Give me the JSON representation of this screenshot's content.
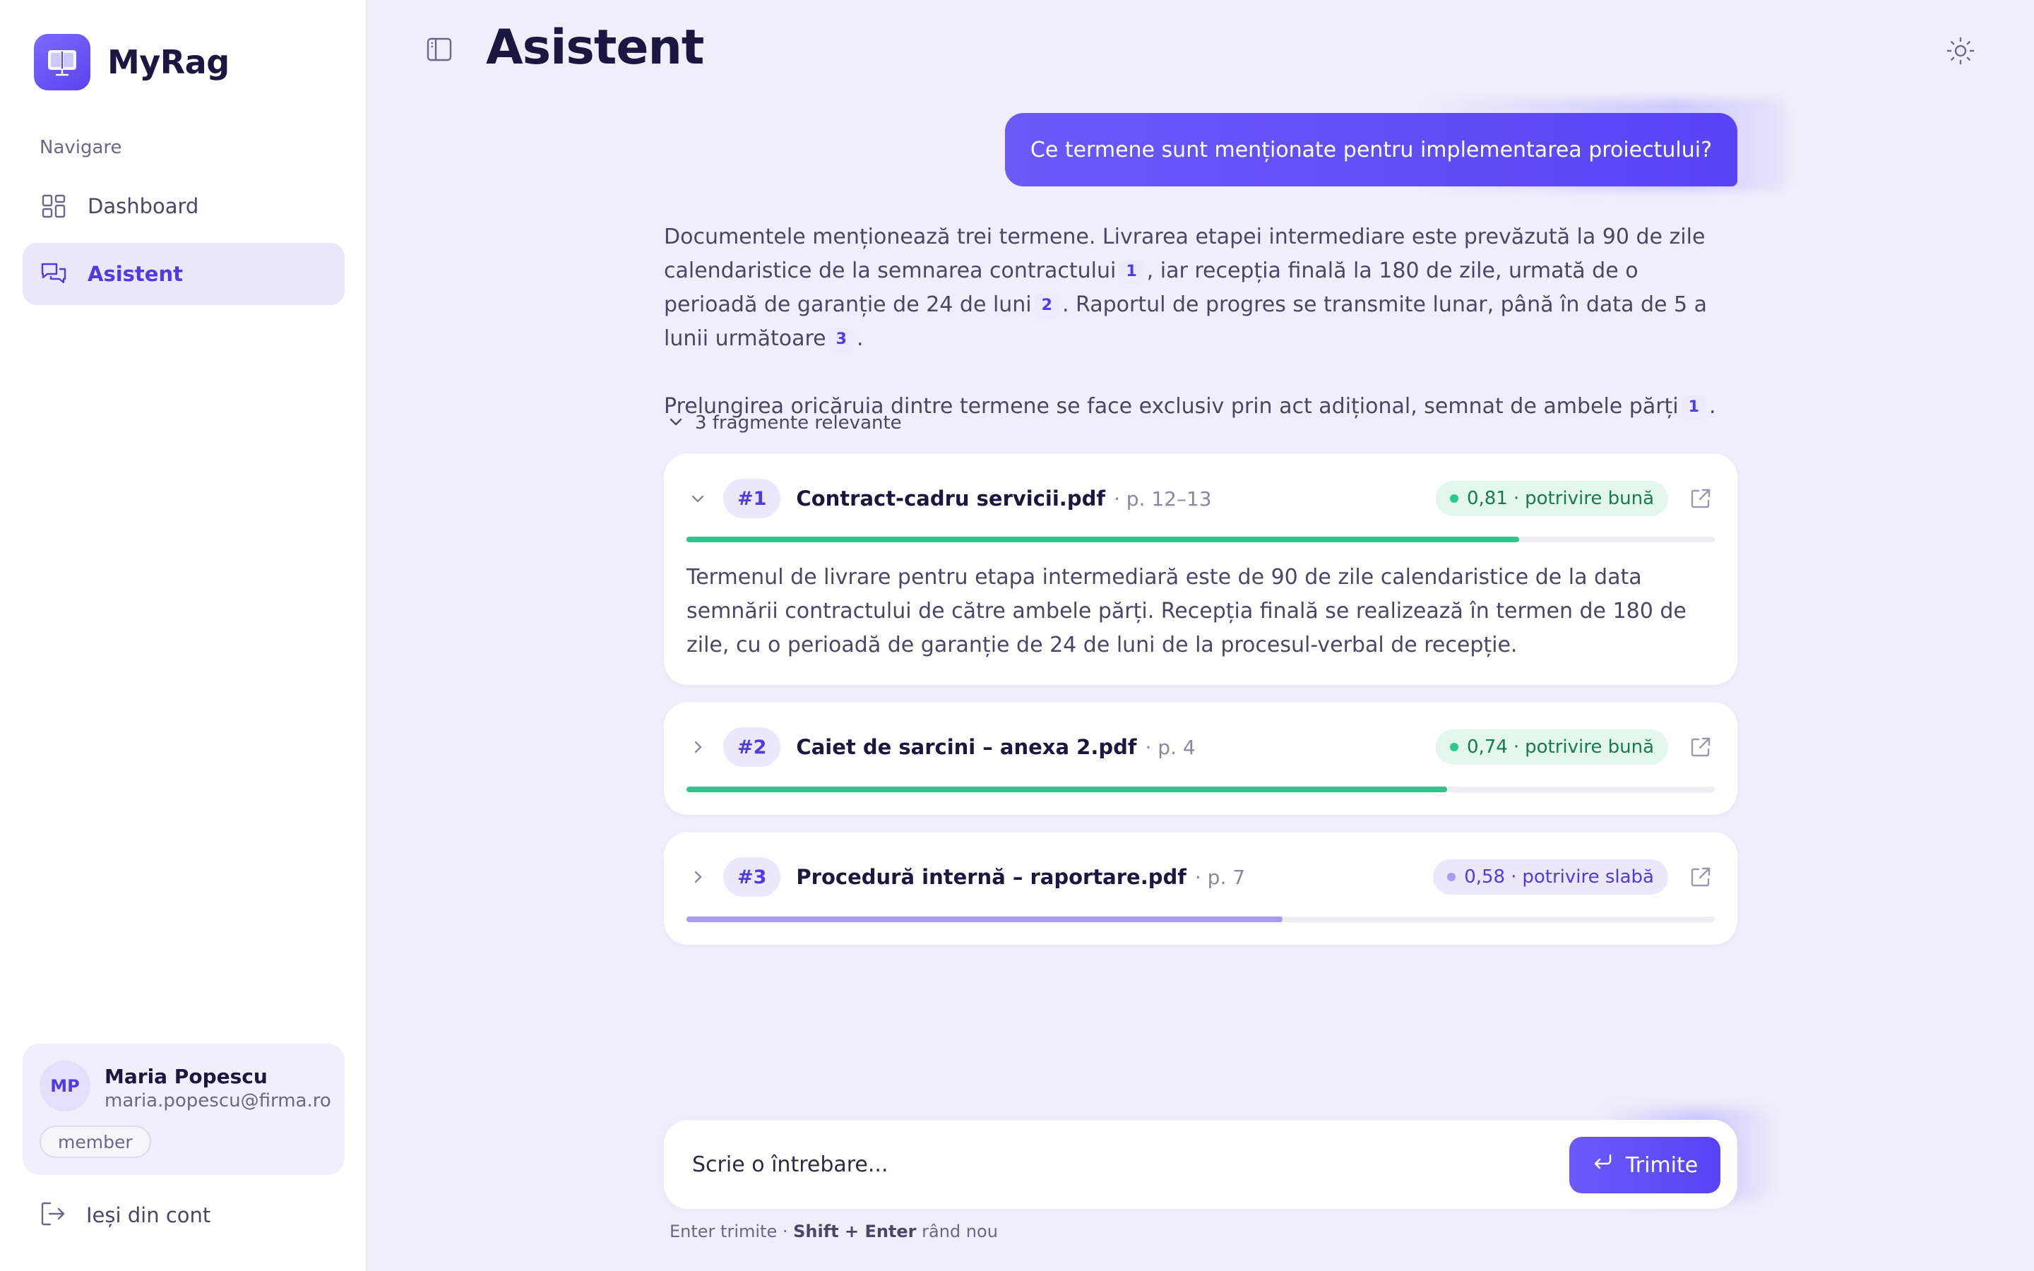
{
  "app": {
    "name": "MyRag"
  },
  "sidebar": {
    "nav_heading": "Navigare",
    "items": [
      {
        "label": "Dashboard",
        "icon": "grid-icon",
        "active": false
      },
      {
        "label": "Asistent",
        "icon": "chat-icon",
        "active": true
      }
    ],
    "user": {
      "initials": "MP",
      "name": "Maria Popescu",
      "email": "maria.popescu@firma.ro",
      "role": "member"
    },
    "logout_label": "Ieși din cont"
  },
  "header": {
    "title": "Asistent"
  },
  "chat": {
    "user_message": "Ce termene sunt menționate pentru implementarea proiectului?",
    "answer": {
      "p1_a": "Documentele menționează trei termene. Livrarea etapei intermediare este prevăzută la 90 de zile calendaristice de la semnarea contractului",
      "cite_1": "1",
      "p1_b": ", iar recepția finală la 180 de zile, urmată de o perioadă de garanție de 24 de luni",
      "cite_2": "2",
      "p1_c": ". Raportul de progres se transmite lunar, până în data de 5 a lunii următoare",
      "cite_3": "3",
      "p1_d": ".",
      "p2_a": "Prelungirea oricăruia dintre termene se face exclusiv prin act adițional, semnat de ambele părți",
      "cite_4": "1",
      "p2_b": "."
    },
    "fragments_toggle": "3 fragmente relevante",
    "fragments": [
      {
        "num": "#1",
        "file": "Contract-cadru servicii.pdf",
        "page": "· p. 12–13",
        "score": "0,81",
        "sep": "·",
        "match": "potrivire bună",
        "relevance": 0.81,
        "expanded": true,
        "text": "Termenul de livrare pentru etapa intermediară este de 90 de zile calendaristice de la data semnării contractului de către ambele părți. Recepția finală se realizează în termen de 180 de zile, cu o perioadă de garanție de 24 de luni de la procesul-verbal de recepție."
      },
      {
        "num": "#2",
        "file": "Caiet de sarcini – anexa 2.pdf",
        "page": "· p. 4",
        "score": "0,74",
        "sep": "·",
        "match": "potrivire bună",
        "relevance": 0.74,
        "expanded": false
      },
      {
        "num": "#3",
        "file": "Procedură internă – raportare.pdf",
        "page": "· p. 7",
        "score": "0,58",
        "sep": "·",
        "match": "potrivire slabă",
        "relevance": 0.58,
        "expanded": false
      }
    ]
  },
  "composer": {
    "placeholder": "Scrie o întrebare...",
    "send_label": "Trimite",
    "hint_key1": "Enter",
    "hint_text1": " trimite · ",
    "hint_key2": "Shift + Enter",
    "hint_text2": " rând nou"
  },
  "colors": {
    "accent": "#5844f5",
    "good": "#2cc78c",
    "weak": "#a79bf2",
    "background": "#f0eefa"
  }
}
